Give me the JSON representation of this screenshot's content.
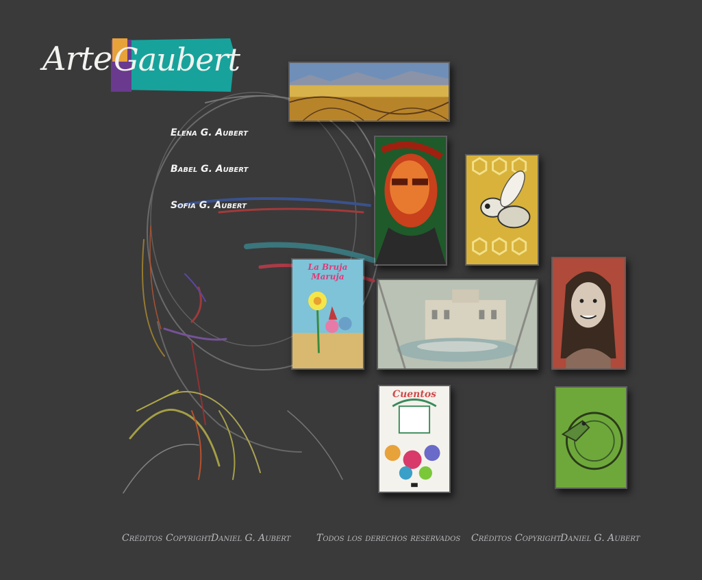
{
  "brand": {
    "arte": "Arte",
    "gaubert": "Gaubert"
  },
  "nav": {
    "items": [
      {
        "label": "Elena G. Aubert"
      },
      {
        "label": "Babel G. Aubert"
      },
      {
        "label": "Sofia G. Aubert"
      }
    ]
  },
  "gallery": {
    "bruja_title": "La Bruja Maruja",
    "cuentos_title": "Cuentos"
  },
  "footer": {
    "left": {
      "creditos": "Créditos",
      "copyright": "Copyright",
      "author": "Daniel G. Aubert"
    },
    "center": "Todos los derechos reservados",
    "right": {
      "creditos": "Créditos",
      "copyright": "Copyright",
      "author": "Daniel G. Aubert"
    }
  },
  "colors": {
    "background": "#3a3a3b",
    "logo_teal": "#17a39c",
    "logo_purple": "#6a3a8e",
    "footer_text": "#b9b9bd"
  }
}
